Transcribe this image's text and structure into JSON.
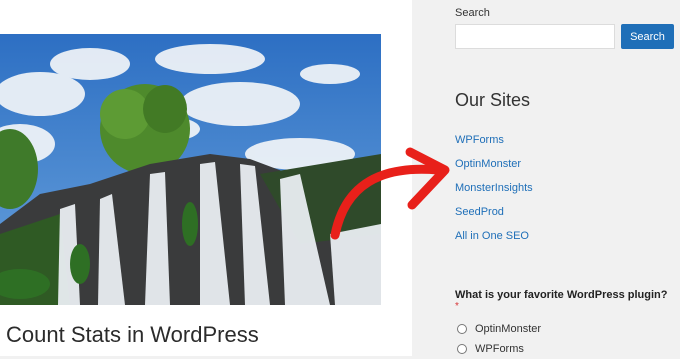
{
  "post": {
    "title": "Count Stats in WordPress"
  },
  "sidebar": {
    "search": {
      "label": "Search",
      "input_value": "",
      "button_label": "Search"
    },
    "our_sites": {
      "title": "Our Sites",
      "links": [
        "WPForms",
        "OptinMonster",
        "MonsterInsights",
        "SeedProd",
        "All in One SEO"
      ]
    },
    "poll": {
      "question": "What is your favorite WordPress plugin?",
      "required_marker": "*",
      "options": [
        "OptinMonster",
        "WPForms"
      ]
    }
  },
  "colors": {
    "link": "#1f6fb8",
    "button": "#1f6fb8",
    "arrow": "#e8201a",
    "sidebar_bg": "#f1f1f1"
  }
}
